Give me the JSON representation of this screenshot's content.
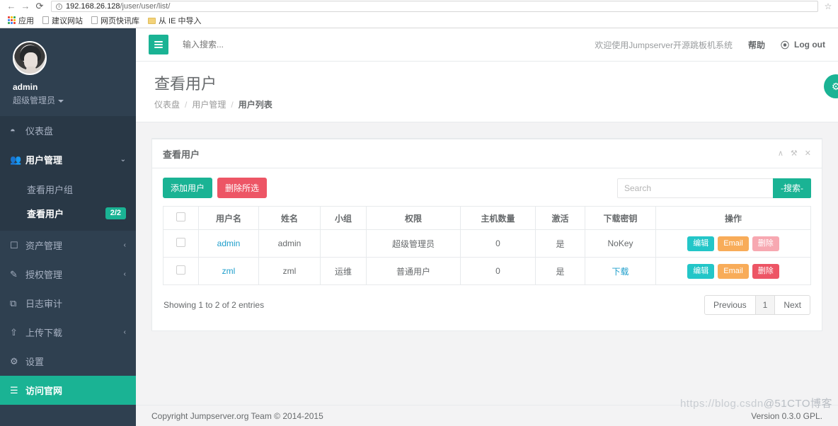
{
  "browser": {
    "back_icon": "back-arrow-icon",
    "forward_icon": "forward-arrow-icon",
    "reload_icon": "reload-icon",
    "url_host": "192.168.26.128",
    "url_path": "/juser/user/list/",
    "star_glyph": "☆",
    "bookmarks": [
      {
        "label": "应用",
        "icon": "apps-grid-icon"
      },
      {
        "label": "建议网站",
        "icon": "page-icon"
      },
      {
        "label": "网页快讯库",
        "icon": "page-icon"
      },
      {
        "label": "从 IE 中导入",
        "icon": "folder-icon"
      }
    ]
  },
  "sidebar": {
    "profile": {
      "name": "admin",
      "role": "超级管理员",
      "avatar_name": "user-avatar"
    },
    "items": [
      {
        "label": "仪表盘",
        "icon": "dashboard-icon",
        "state": "dashboard",
        "arrow": ""
      },
      {
        "label": "用户管理",
        "icon": "users-icon",
        "state": "active-parent",
        "arrow": "⌄"
      },
      {
        "label": "资产管理",
        "icon": "inbox-icon",
        "state": "",
        "arrow": "‹"
      },
      {
        "label": "授权管理",
        "icon": "edit-square-icon",
        "state": "",
        "arrow": "‹"
      },
      {
        "label": "日志审计",
        "icon": "clone-icon",
        "state": "",
        "arrow": ""
      },
      {
        "label": "上传下载",
        "icon": "upload-icon",
        "state": "",
        "arrow": "‹"
      },
      {
        "label": "设置",
        "icon": "gears-icon",
        "state": "",
        "arrow": ""
      },
      {
        "label": "访问官网",
        "icon": "server-icon",
        "state": "highlight",
        "arrow": ""
      }
    ],
    "sub_items": [
      {
        "label": "查看用户组",
        "badge": "",
        "active": false
      },
      {
        "label": "查看用户",
        "badge": "2/2",
        "active": true
      }
    ]
  },
  "topnav": {
    "search_placeholder": "输入搜索...",
    "search_value": "",
    "welcome": "欢迎使用Jumpserver开源跳板机系统",
    "help": "帮助",
    "logout": "Log out",
    "logout_icon": "sign-out-icon",
    "menu_icon": "hamburger-menu-icon"
  },
  "page": {
    "title": "查看用户",
    "breadcrumb": [
      {
        "label": "仪表盘",
        "current": false
      },
      {
        "label": "用户管理",
        "current": false
      },
      {
        "label": "用户列表",
        "current": true
      }
    ],
    "breadcrumb_sep": "/",
    "fab_icon": "gear-icon"
  },
  "panel": {
    "title": "查看用户",
    "tools": [
      {
        "icon": "chevron-up-icon",
        "glyph": "∧"
      },
      {
        "icon": "wrench-icon",
        "glyph": "⚒"
      },
      {
        "icon": "close-icon",
        "glyph": "✕"
      }
    ],
    "add_user_label": "添加用户",
    "delete_selected_label": "删除所选",
    "search_placeholder": "Search",
    "search_value": "",
    "search_button_label": "-搜索-"
  },
  "table": {
    "columns": [
      "",
      "用户名",
      "姓名",
      "小组",
      "权限",
      "主机数量",
      "激活",
      "下载密钥",
      "操作"
    ],
    "rows": [
      {
        "username": "admin",
        "name": "admin",
        "group": "",
        "permission": "超级管理员",
        "hosts": "0",
        "active": "是",
        "key": "NoKey",
        "key_is_link": false,
        "actions": [
          {
            "label": "编辑",
            "style": "edit"
          },
          {
            "label": "Email",
            "style": "email"
          },
          {
            "label": "删除",
            "style": "del-faded"
          }
        ]
      },
      {
        "username": "zml",
        "name": "zml",
        "group": "运维",
        "permission": "普通用户",
        "hosts": "0",
        "active": "是",
        "key": "下载",
        "key_is_link": true,
        "actions": [
          {
            "label": "编辑",
            "style": "edit"
          },
          {
            "label": "Email",
            "style": "email"
          },
          {
            "label": "删除",
            "style": "del"
          }
        ]
      }
    ],
    "entries_info": "Showing 1 to 2 of 2 entries",
    "pagination": {
      "previous": "Previous",
      "current_page": "1",
      "next": "Next"
    }
  },
  "footer": {
    "copyright": "Copyright Jumpserver.org Team © 2014-2015",
    "version": "Version 0.3.0 GPL."
  },
  "watermark": {
    "line1": "https://blog.csdn",
    "line2": "@51CTO博客"
  },
  "colors": {
    "brand_green": "#1ab394",
    "danger_red": "#ed5565",
    "teal": "#23c6c8",
    "orange": "#f8ac59",
    "sidebar_bg": "#2f4050",
    "sidebar_sub_bg": "#293846",
    "link_blue": "#1e9ecb"
  }
}
